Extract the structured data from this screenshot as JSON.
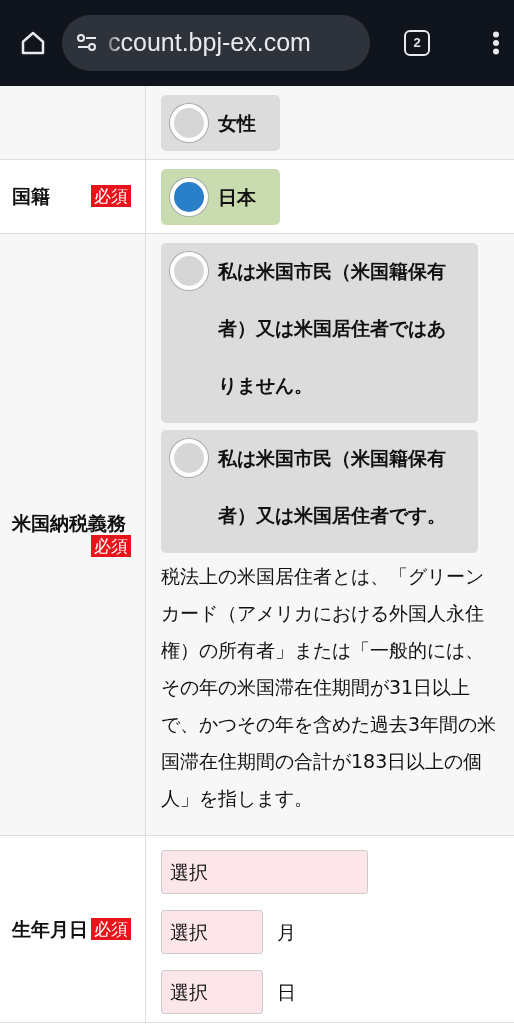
{
  "browser": {
    "url": "ccount.bpj-ex.com",
    "tab_count": "2"
  },
  "form": {
    "rows": [
      {
        "kind": "radio",
        "options": [
          {
            "label": "女性",
            "selected": false
          }
        ]
      },
      {
        "kind": "radio",
        "label": "国籍",
        "required": "必須",
        "options": [
          {
            "label": "日本",
            "selected": true
          }
        ]
      },
      {
        "kind": "radio",
        "label": "米国納税義務",
        "required": "必須",
        "options": [
          {
            "label": "私は米国市民（米国籍保有者）又は米国居住者ではありません。",
            "selected": false
          },
          {
            "label": "私は米国市民（米国籍保有者）又は米国居住者です。",
            "selected": false
          }
        ],
        "note": "税法上の米国居住者とは、「グリーンカード（アメリカにおける外国人永住権）の所有者」または「一般的には、その年の米国滞在住期間が31日以上で、かつその年を含めた過去3年間の米国滞在住期間の合計が183日以上の個人」を指します。"
      },
      {
        "kind": "date",
        "label": "生年月日",
        "required": "必須",
        "selects": [
          {
            "value": "選択"
          },
          {
            "value": "選択",
            "unit": "月"
          },
          {
            "value": "選択",
            "unit": "日"
          }
        ]
      }
    ]
  }
}
